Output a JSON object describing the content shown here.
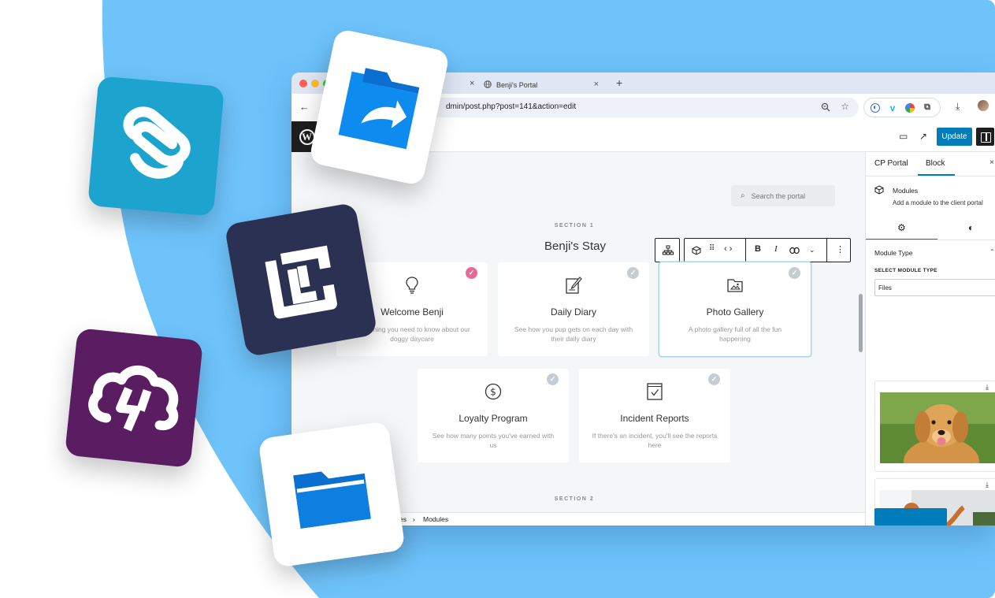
{
  "browser": {
    "tabs": [
      {
        "label": "Benji's Portal",
        "close": "×"
      }
    ],
    "new_tab": "+",
    "url": "dmin/post.php?post=141&action=edit"
  },
  "editor": {
    "update_label": "Update",
    "search_placeholder": "Search the portal",
    "section1_label": "SECTION 1",
    "section1_title": "Benji's Stay",
    "section2_label": "SECTION 2",
    "breadcrumb": {
      "prev": "es",
      "sep": "›",
      "current": "Modules"
    },
    "modules": [
      {
        "title": "Welcome Benji",
        "desc": "Everything you need to know about our doggy daycare",
        "icon": "lightbulb-icon",
        "check": "pink"
      },
      {
        "title": "Daily Diary",
        "desc": "See how you pup gets on each day with their daily diary",
        "icon": "diary-icon",
        "check": "grey"
      },
      {
        "title": "Photo Gallery",
        "desc": "A photo gallery full of all the fun happening",
        "icon": "folder-image-icon",
        "check": "grey",
        "selected": true
      },
      {
        "title": "Loyalty Program",
        "desc": "See how many points you've earned with us",
        "icon": "dollar-coin-icon",
        "check": "grey"
      },
      {
        "title": "Incident Reports",
        "desc": "If there's an incident, you'll see the reports here",
        "icon": "report-check-icon",
        "check": "grey"
      }
    ],
    "toolbar": {
      "bold": "B",
      "italic": "I"
    }
  },
  "sidebar": {
    "tab_portal": "CP Portal",
    "tab_block": "Block",
    "close": "×",
    "block_title": "Modules",
    "block_desc": "Add a module to the client portal",
    "panel_title": "Module Type",
    "select_label": "SELECT MODULE TYPE",
    "select_value": "Files"
  },
  "colors": {
    "accent": "#007cba",
    "background_blue": "#6ec3fb",
    "pink_check": "#e56a98"
  }
}
